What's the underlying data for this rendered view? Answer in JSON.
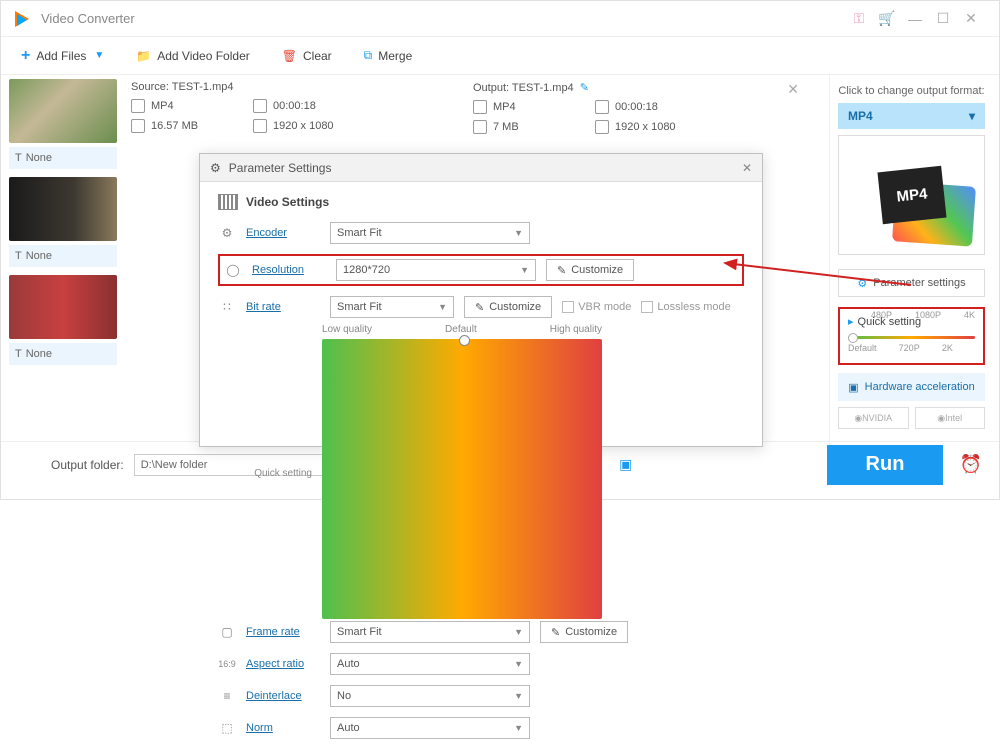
{
  "title": "Video Converter",
  "toolbar": {
    "add": "Add Files",
    "folder": "Add Video Folder",
    "clear": "Clear",
    "merge": "Merge"
  },
  "none": "None",
  "source": {
    "label": "Source: TEST-1.mp4",
    "format": "MP4",
    "duration": "00:00:18",
    "size": "16.57 MB",
    "res": "1920 x 1080"
  },
  "output": {
    "label": "Output: TEST-1.mp4",
    "format": "MP4",
    "duration": "00:00:18",
    "size": "7 MB",
    "res": "1920 x 1080"
  },
  "right": {
    "click": "Click to change output format:",
    "fmt": "MP4",
    "preview": "MP4",
    "param": "Parameter settings",
    "quick": "Quick setting",
    "t1": "480P",
    "t2": "1080P",
    "t3": "4K",
    "t4": "Default",
    "t5": "720P",
    "t6": "2K",
    "hw": "Hardware acceleration",
    "nv": "NVIDIA",
    "intel": "Intel"
  },
  "footer": {
    "label": "Output folder:",
    "path": "D:\\New folder",
    "run": "Run"
  },
  "modal": {
    "title": "Parameter Settings",
    "section": "Video Settings",
    "encoder": "Encoder",
    "encoder_v": "Smart Fit",
    "resolution": "Resolution",
    "resolution_v": "1280*720",
    "customize": "Customize",
    "bitrate": "Bit rate",
    "bitrate_v": "Smart Fit",
    "vbr": "VBR mode",
    "lossless": "Lossless mode",
    "qs": "Quick setting",
    "low": "Low quality",
    "def": "Default",
    "high": "High quality",
    "framerate": "Frame rate",
    "framerate_v": "Smart Fit",
    "aspect": "Aspect ratio",
    "aspect_v": "Auto",
    "deint": "Deinterlace",
    "deint_v": "No",
    "norm": "Norm",
    "norm_v": "Auto"
  }
}
